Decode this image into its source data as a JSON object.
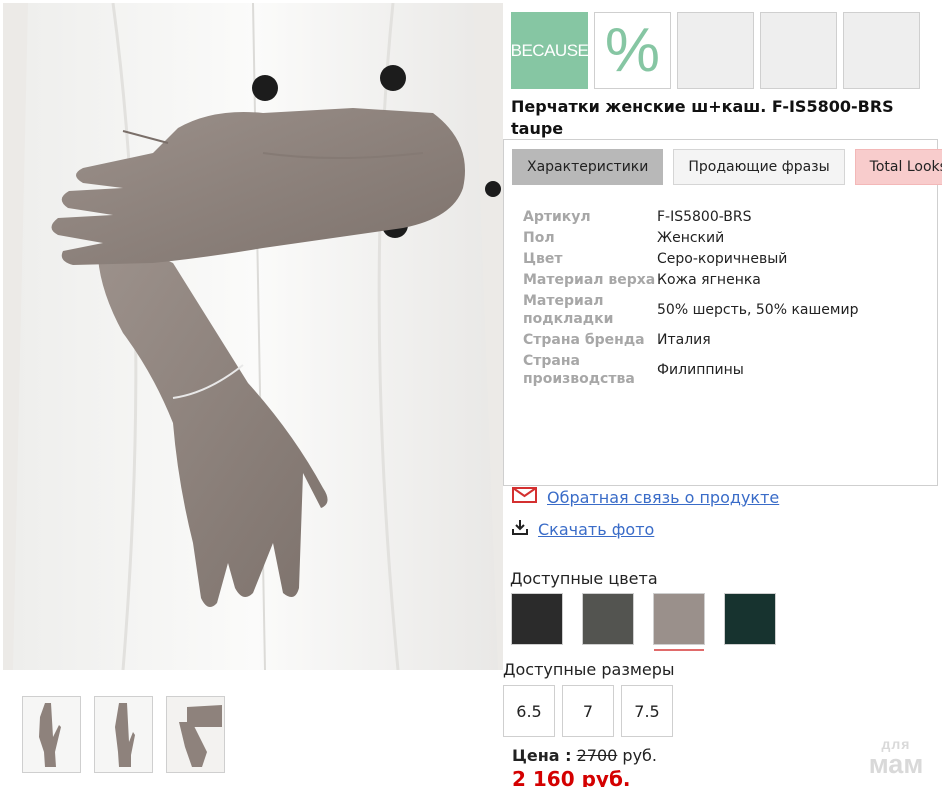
{
  "badges": {
    "because": "BECAUSE",
    "percent": "%"
  },
  "product": {
    "title": "Перчатки женские ш+каш. F-IS5800-BRS taupe"
  },
  "tabs": [
    {
      "label": "Характеристики"
    },
    {
      "label": "Продающие фразы"
    },
    {
      "label": "Total Looks"
    }
  ],
  "specs": [
    {
      "label": "Артикул",
      "value": "F-IS5800-BRS"
    },
    {
      "label": "Пол",
      "value": "Женский"
    },
    {
      "label": "Цвет",
      "value": "Серо-коричневый"
    },
    {
      "label": "Материал верха",
      "value": "Кожа ягненка"
    },
    {
      "label": "Материал подкладки",
      "value": "50% шерсть, 50% кашемир"
    },
    {
      "label": "Страна бренда",
      "value": "Италия"
    },
    {
      "label": "Страна производства",
      "value": "Филиппины"
    }
  ],
  "links": {
    "feedback": "Обратная связь о продукте",
    "download": "Скачать фото"
  },
  "colors": {
    "label": "Доступные цвета",
    "swatches": [
      {
        "color": "#2b2b2b",
        "selected": false
      },
      {
        "color": "#535450",
        "selected": false
      },
      {
        "color": "#9a908b",
        "selected": true
      },
      {
        "color": "#17332f",
        "selected": false
      }
    ]
  },
  "sizes": {
    "label": "Доступные размеры",
    "options": [
      "6.5",
      "7",
      "7.5"
    ]
  },
  "price": {
    "label": "Цена :",
    "old": "2700",
    "currency": " руб.",
    "new": "2 160 руб."
  },
  "watermark": {
    "line1": "для",
    "line2": "мам"
  },
  "palette": {
    "accent_green": "#86c6a3",
    "link": "#3a6cc8",
    "price_red": "#d40000",
    "glove": "#8e827c"
  }
}
